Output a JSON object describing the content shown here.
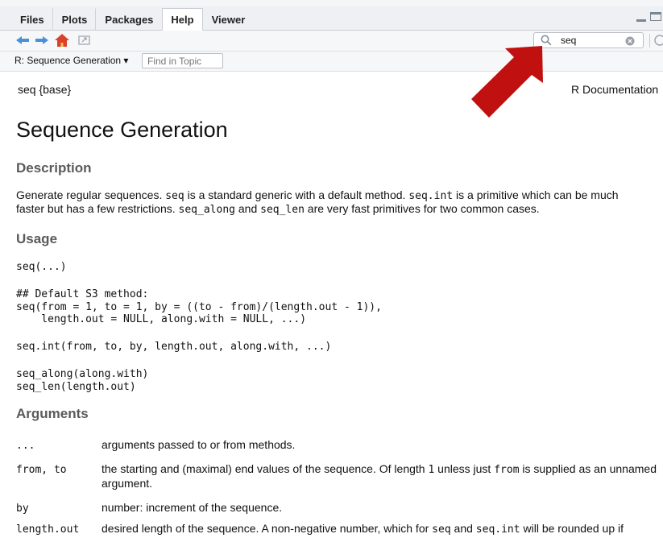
{
  "tabs": [
    "Files",
    "Plots",
    "Packages",
    "Help",
    "Viewer"
  ],
  "active_tab": "Help",
  "search": {
    "value": "seq"
  },
  "topic": {
    "label": "R: Sequence Generation ▾",
    "find_placeholder": "Find in Topic"
  },
  "doc": {
    "header_left": "seq {base}",
    "header_right": "R Documentation",
    "title": "Sequence Generation",
    "description_heading": "Description",
    "description_line1": [
      {
        "t": "Generate regular sequences. ",
        "code": false
      },
      {
        "t": "seq",
        "code": true
      },
      {
        "t": " is a standard generic with a default method. ",
        "code": false
      },
      {
        "t": "seq.int",
        "code": true
      },
      {
        "t": " is a primitive which can be much",
        "code": false
      }
    ],
    "description_line2": [
      {
        "t": "faster but has a few restrictions. ",
        "code": false
      },
      {
        "t": "seq_along",
        "code": true
      },
      {
        "t": " and ",
        "code": false
      },
      {
        "t": "seq_len",
        "code": true
      },
      {
        "t": " are very fast primitives for two common cases.",
        "code": false
      }
    ],
    "usage_heading": "Usage",
    "usage_1": "seq(...)",
    "usage_2": "## Default S3 method:\nseq(from = 1, to = 1, by = ((to - from)/(length.out - 1)),\n    length.out = NULL, along.with = NULL, ...)",
    "usage_3": "seq.int(from, to, by, length.out, along.with, ...)",
    "usage_4": "seq_along(along.with)\nseq_len(length.out)",
    "arguments_heading": "Arguments",
    "arguments": [
      {
        "name": "...",
        "desc": [
          {
            "t": "arguments passed to or from methods.",
            "code": false
          }
        ]
      },
      {
        "name": "from, to",
        "desc": [
          {
            "t": "the starting and (maximal) end values of the sequence. Of length ",
            "code": false
          },
          {
            "t": "1",
            "code": true
          },
          {
            "t": " unless just ",
            "code": false
          },
          {
            "t": "from",
            "code": true
          },
          {
            "t": " is supplied as an unnamed argument.",
            "code": false
          }
        ]
      },
      {
        "name": "by",
        "desc": [
          {
            "t": "number: increment of the sequence.",
            "code": false
          }
        ]
      },
      {
        "name": "length.out",
        "desc": [
          {
            "t": "desired length of the sequence. A non-negative number, which for ",
            "code": false
          },
          {
            "t": "seq",
            "code": true
          },
          {
            "t": " and ",
            "code": false
          },
          {
            "t": "seq.int",
            "code": true
          },
          {
            "t": " will be rounded up if fractional.",
            "code": false
          }
        ]
      }
    ]
  },
  "colors": {
    "arrow": "#c0100f",
    "heading": "#5a5a5a",
    "nav_arrow": "#4a90d9",
    "home": "#d9412b"
  },
  "icons": [
    "back-arrow-icon",
    "forward-arrow-icon",
    "home-icon",
    "open-in-window-icon",
    "search-icon",
    "clear-search-icon",
    "refresh-icon",
    "minimize-icon",
    "maximize-icon"
  ]
}
